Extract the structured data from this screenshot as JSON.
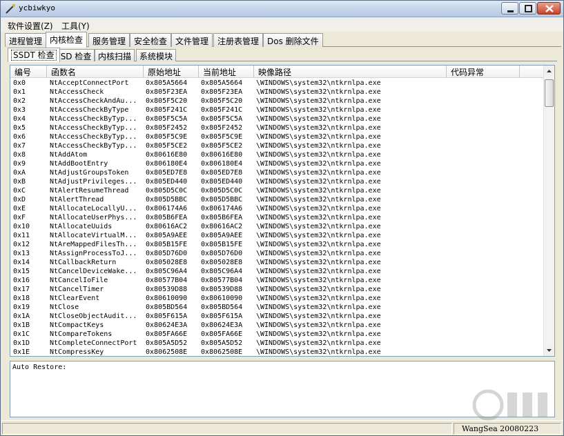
{
  "window": {
    "title": "ycbiwkyo"
  },
  "menu": [
    {
      "label": "软件设置(Z)"
    },
    {
      "label": "工具(Y)"
    }
  ],
  "main_tabs": [
    {
      "label": "进程管理"
    },
    {
      "label": "内核检查"
    },
    {
      "label": "服务管理"
    },
    {
      "label": "安全检查"
    },
    {
      "label": "文件管理"
    },
    {
      "label": "注册表管理"
    },
    {
      "label": "Dos 删除文件"
    }
  ],
  "active_main_tab": "内核检查",
  "sub_tabs": [
    {
      "label": "SSDT 检查"
    },
    {
      "label": "FSD 检查"
    },
    {
      "label": "内核扫描"
    },
    {
      "label": "系统模块"
    }
  ],
  "active_sub_tab": "SSDT 检查",
  "columns": [
    {
      "label": "编号"
    },
    {
      "label": "函数名"
    },
    {
      "label": "原始地址"
    },
    {
      "label": "当前地址"
    },
    {
      "label": "映像路径"
    },
    {
      "label": "代码异常"
    }
  ],
  "rows": [
    [
      "0x0",
      "NtAcceptConnectPort",
      "0x805A5664",
      "0x805A5664",
      "\\WINDOWS\\system32\\ntkrnlpa.exe",
      ""
    ],
    [
      "0x1",
      "NtAccessCheck",
      "0x805F23EA",
      "0x805F23EA",
      "\\WINDOWS\\system32\\ntkrnlpa.exe",
      ""
    ],
    [
      "0x2",
      "NtAccessCheckAndAu...",
      "0x805F5C20",
      "0x805F5C20",
      "\\WINDOWS\\system32\\ntkrnlpa.exe",
      ""
    ],
    [
      "0x3",
      "NtAccessCheckByType",
      "0x805F241C",
      "0x805F241C",
      "\\WINDOWS\\system32\\ntkrnlpa.exe",
      ""
    ],
    [
      "0x4",
      "NtAccessCheckByTyp...",
      "0x805F5C5A",
      "0x805F5C5A",
      "\\WINDOWS\\system32\\ntkrnlpa.exe",
      ""
    ],
    [
      "0x5",
      "NtAccessCheckByTyp...",
      "0x805F2452",
      "0x805F2452",
      "\\WINDOWS\\system32\\ntkrnlpa.exe",
      ""
    ],
    [
      "0x6",
      "NtAccessCheckByTyp...",
      "0x805F5C9E",
      "0x805F5C9E",
      "\\WINDOWS\\system32\\ntkrnlpa.exe",
      ""
    ],
    [
      "0x7",
      "NtAccessCheckByTyp...",
      "0x805F5CE2",
      "0x805F5CE2",
      "\\WINDOWS\\system32\\ntkrnlpa.exe",
      ""
    ],
    [
      "0x8",
      "NtAddAtom",
      "0x80616E80",
      "0x80616E80",
      "\\WINDOWS\\system32\\ntkrnlpa.exe",
      ""
    ],
    [
      "0x9",
      "NtAddBootEntry",
      "0x806180E4",
      "0x806180E4",
      "\\WINDOWS\\system32\\ntkrnlpa.exe",
      ""
    ],
    [
      "0xA",
      "NtAdjustGroupsToken",
      "0x805ED7E8",
      "0x805ED7E8",
      "\\WINDOWS\\system32\\ntkrnlpa.exe",
      ""
    ],
    [
      "0xB",
      "NtAdjustPrivileges...",
      "0x805ED440",
      "0x805ED440",
      "\\WINDOWS\\system32\\ntkrnlpa.exe",
      ""
    ],
    [
      "0xC",
      "NtAlertResumeThread",
      "0x805D5C0C",
      "0x805D5C0C",
      "\\WINDOWS\\system32\\ntkrnlpa.exe",
      ""
    ],
    [
      "0xD",
      "NtAlertThread",
      "0x805D5BBC",
      "0x805D5BBC",
      "\\WINDOWS\\system32\\ntkrnlpa.exe",
      ""
    ],
    [
      "0xE",
      "NtAllocateLocallyU...",
      "0x806174A6",
      "0x806174A6",
      "\\WINDOWS\\system32\\ntkrnlpa.exe",
      ""
    ],
    [
      "0xF",
      "NtAllocateUserPhys...",
      "0x805B6FEA",
      "0x805B6FEA",
      "\\WINDOWS\\system32\\ntkrnlpa.exe",
      ""
    ],
    [
      "0x10",
      "NtAllocateUuids",
      "0x80616AC2",
      "0x80616AC2",
      "\\WINDOWS\\system32\\ntkrnlpa.exe",
      ""
    ],
    [
      "0x11",
      "NtAllocateVirtualM...",
      "0x805A9AEE",
      "0x805A9AEE",
      "\\WINDOWS\\system32\\ntkrnlpa.exe",
      ""
    ],
    [
      "0x12",
      "NtAreMappedFilesTh...",
      "0x805B15FE",
      "0x805B15FE",
      "\\WINDOWS\\system32\\ntkrnlpa.exe",
      ""
    ],
    [
      "0x13",
      "NtAssignProcessToJ...",
      "0x805D76D0",
      "0x805D76D0",
      "\\WINDOWS\\system32\\ntkrnlpa.exe",
      ""
    ],
    [
      "0x14",
      "NtCallbackReturn",
      "0x805028E8",
      "0x805028E8",
      "\\WINDOWS\\system32\\ntkrnlpa.exe",
      ""
    ],
    [
      "0x15",
      "NtCancelDeviceWake...",
      "0x805C96A4",
      "0x805C96A4",
      "\\WINDOWS\\system32\\ntkrnlpa.exe",
      ""
    ],
    [
      "0x16",
      "NtCancelIoFile",
      "0x80577B04",
      "0x80577B04",
      "\\WINDOWS\\system32\\ntkrnlpa.exe",
      ""
    ],
    [
      "0x17",
      "NtCancelTimer",
      "0x80539D88",
      "0x80539D88",
      "\\WINDOWS\\system32\\ntkrnlpa.exe",
      ""
    ],
    [
      "0x18",
      "NtClearEvent",
      "0x80610090",
      "0x80610090",
      "\\WINDOWS\\system32\\ntkrnlpa.exe",
      ""
    ],
    [
      "0x19",
      "NtClose",
      "0x805BD564",
      "0x805BD564",
      "\\WINDOWS\\system32\\ntkrnlpa.exe",
      ""
    ],
    [
      "0x1A",
      "NtCloseObjectAudit...",
      "0x805F615A",
      "0x805F615A",
      "\\WINDOWS\\system32\\ntkrnlpa.exe",
      ""
    ],
    [
      "0x1B",
      "NtCompactKeys",
      "0x80624E3A",
      "0x80624E3A",
      "\\WINDOWS\\system32\\ntkrnlpa.exe",
      ""
    ],
    [
      "0x1C",
      "NtCompareTokens",
      "0x805FA66E",
      "0x805FA66E",
      "\\WINDOWS\\system32\\ntkrnlpa.exe",
      ""
    ],
    [
      "0x1D",
      "NtCompleteConnectPort",
      "0x805A5D52",
      "0x805A5D52",
      "\\WINDOWS\\system32\\ntkrnlpa.exe",
      ""
    ],
    [
      "0x1E",
      "NtCompressKey",
      "0x8062508E",
      "0x8062508E",
      "\\WINDOWS\\system32\\ntkrnlpa.exe",
      ""
    ]
  ],
  "log": {
    "text": "Auto Restore:"
  },
  "status": {
    "text": "WangSea 20080223"
  }
}
